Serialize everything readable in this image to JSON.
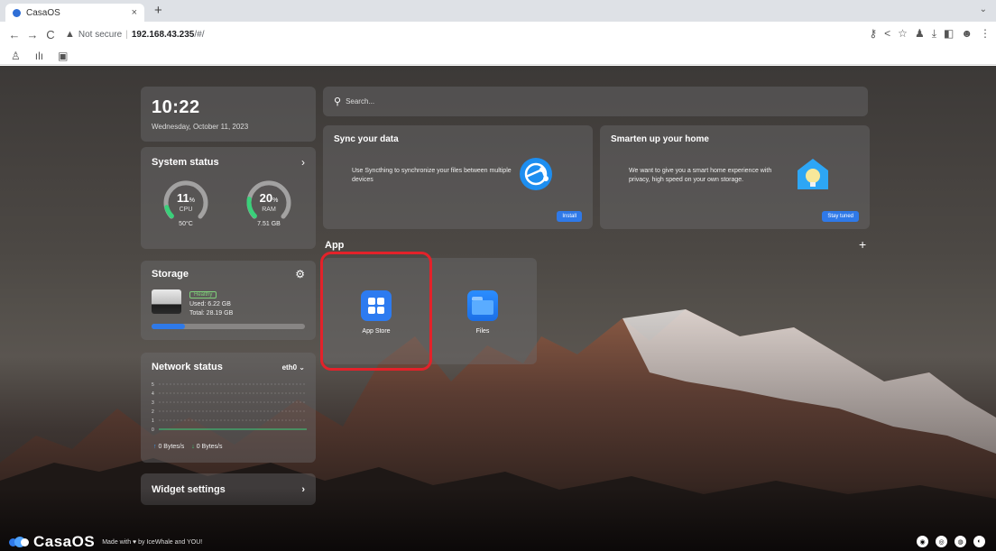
{
  "browser": {
    "tab_title": "CasaOS",
    "tab_close": "×",
    "new_tab": "+",
    "tab_menu": "⌄",
    "nav_back": "←",
    "nav_forward": "→",
    "nav_reload": "C",
    "security_label": "Not secure",
    "url_host": "192.168.43.235",
    "url_path": "/#/"
  },
  "clock": {
    "time": "10:22",
    "date": "Wednesday, October 11, 2023"
  },
  "system_status": {
    "title": "System status",
    "cpu": {
      "value": "11",
      "unit": "%",
      "label": "CPU",
      "sub": "50°C",
      "percent": 11
    },
    "ram": {
      "value": "20",
      "unit": "%",
      "label": "RAM",
      "sub": "7.51 GB",
      "percent": 20
    }
  },
  "storage": {
    "title": "Storage",
    "health": "Healthy",
    "used": "Used: 6.22 GB",
    "total": "Total: 28.19 GB",
    "usage_fraction": 0.22
  },
  "network": {
    "title": "Network status",
    "interface": "eth0",
    "y_ticks": [
      "5",
      "4",
      "3",
      "2",
      "1",
      "0"
    ],
    "upload": "0 Bytes/s",
    "download": "0 Bytes/s"
  },
  "widget_settings": {
    "label": "Widget settings"
  },
  "search": {
    "placeholder": "Search..."
  },
  "promos": {
    "sync": {
      "title": "Sync your data",
      "description": "Use Syncthing to synchronize your files between multiple devices",
      "button": "Install"
    },
    "home": {
      "title": "Smarten up your home",
      "description": "We want to give you a smart home experience with privacy, high speed on your own storage.",
      "button": "Stay tuned"
    }
  },
  "apps": {
    "section_title": "App",
    "add": "+",
    "items": [
      {
        "label": "App Store"
      },
      {
        "label": "Files"
      }
    ]
  },
  "footer": {
    "brand": "CasaOS",
    "made_with": "Made with ♥ by IceWhale and YOU!"
  },
  "colors": {
    "accent": "#2f79e8",
    "highlight_ring": "#e3222a",
    "gauge_green": "#3ad07a",
    "healthy": "#7fd07a"
  }
}
